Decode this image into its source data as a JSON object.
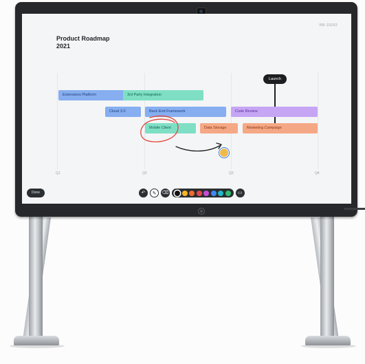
{
  "board": {
    "page_id": "RB-10292",
    "title_line1": "Product Roadmap",
    "title_line2": "2021"
  },
  "quarters": [
    "Q1",
    "Q2",
    "Q3",
    "Q4"
  ],
  "tasks": [
    {
      "label": "Extensions Platform",
      "color": "blue"
    },
    {
      "label": "3rd Party Integration",
      "color": "teal"
    },
    {
      "label": "Cloud 3.0",
      "color": "blue"
    },
    {
      "label": "Back End Framework",
      "color": "blue"
    },
    {
      "label": "Code Review",
      "color": "purple"
    },
    {
      "label": "Mobile Client",
      "color": "teal"
    },
    {
      "label": "Data Storage",
      "color": "orange"
    },
    {
      "label": "Marketing Campaign",
      "color": "orange"
    }
  ],
  "milestone": {
    "label": "Launch"
  },
  "toolbar": {
    "done_label": "Done",
    "tools": [
      "undo-icon",
      "pen-icon",
      "eraser-icon"
    ],
    "colors": [
      "#111111",
      "#f5b728",
      "#f26a2e",
      "#e5484d",
      "#c94bd6",
      "#3d8bf0",
      "#22b8c8",
      "#2fbf71"
    ],
    "selected_color_index": 0,
    "extra_tool": "sticky-note-icon"
  },
  "colors": {
    "bezel": "#26282b",
    "screen": "#f4f5f6",
    "ink_red": "#e0453a",
    "ink_black": "#1c1e21"
  }
}
